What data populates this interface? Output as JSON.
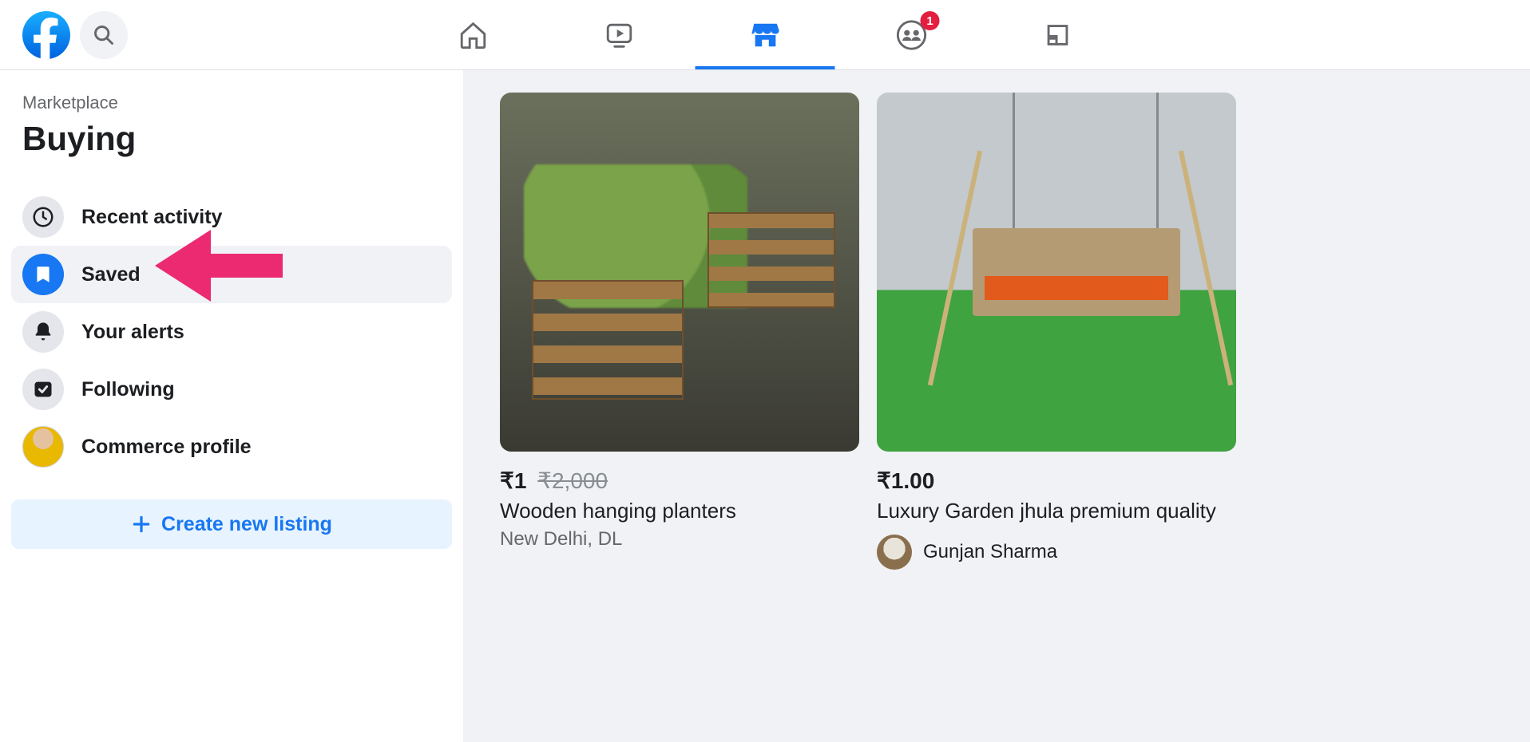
{
  "header": {
    "notifications_badge": "1"
  },
  "sidebar": {
    "breadcrumb": "Marketplace",
    "title": "Buying",
    "items": [
      {
        "label": "Recent activity"
      },
      {
        "label": "Saved"
      },
      {
        "label": "Your alerts"
      },
      {
        "label": "Following"
      },
      {
        "label": "Commerce profile"
      }
    ],
    "create_button": "Create new listing"
  },
  "listings": [
    {
      "price": "₹1",
      "old_price": "₹2,000",
      "title": "Wooden hanging planters",
      "subtitle": "New Delhi, DL"
    },
    {
      "price": "₹1.00",
      "title": "Luxury Garden jhula premium quality",
      "seller": "Gunjan Sharma"
    }
  ]
}
